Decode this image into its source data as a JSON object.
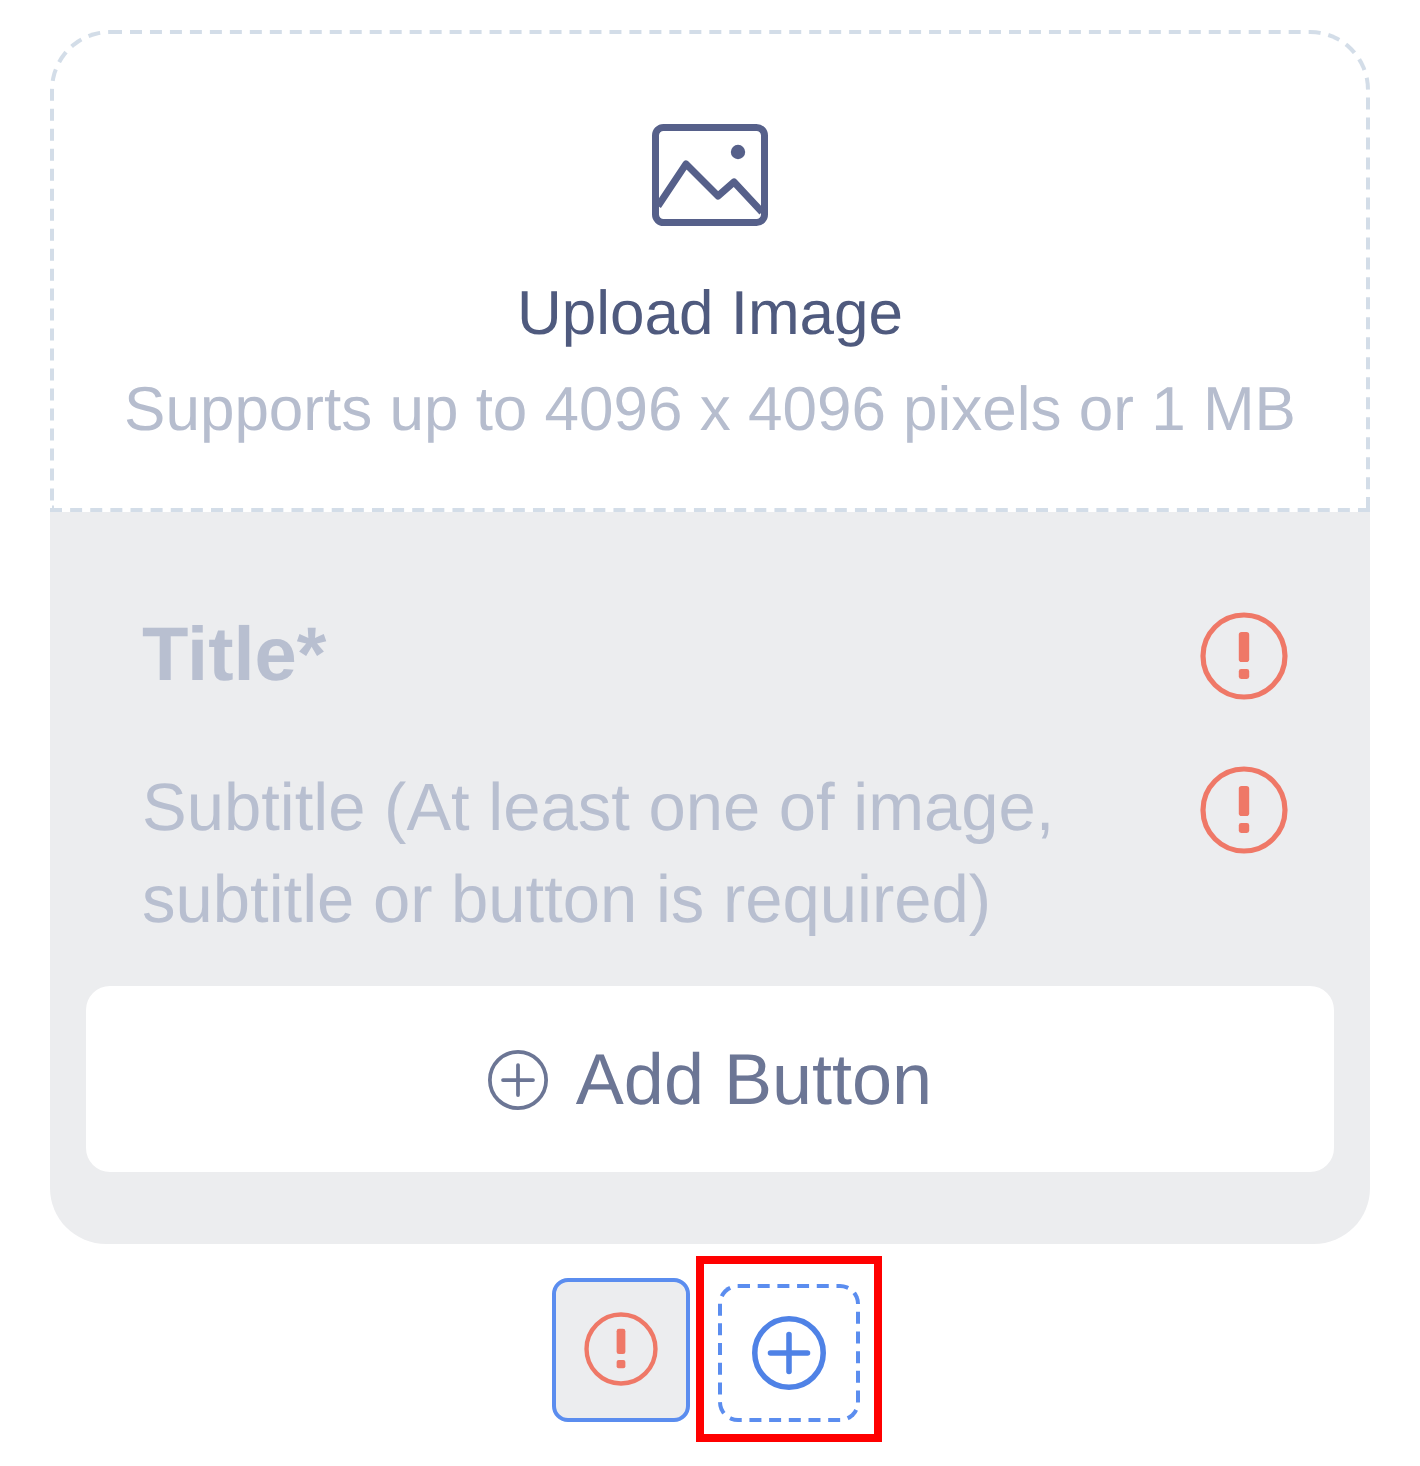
{
  "upload": {
    "title": "Upload Image",
    "hint": "Supports up to 4096 x 4096 pixels or 1 MB"
  },
  "fields": [
    {
      "kind": "title",
      "placeholder": "Title*",
      "error": true
    },
    {
      "kind": "subtitle",
      "placeholder": "Subtitle (At least one of image, subtitle or button is required)",
      "error": true
    }
  ],
  "add_button": {
    "label": "Add Button"
  },
  "pager": [
    {
      "kind": "card",
      "selected": true,
      "error": true
    },
    {
      "kind": "add",
      "highlighted": true
    }
  ]
}
